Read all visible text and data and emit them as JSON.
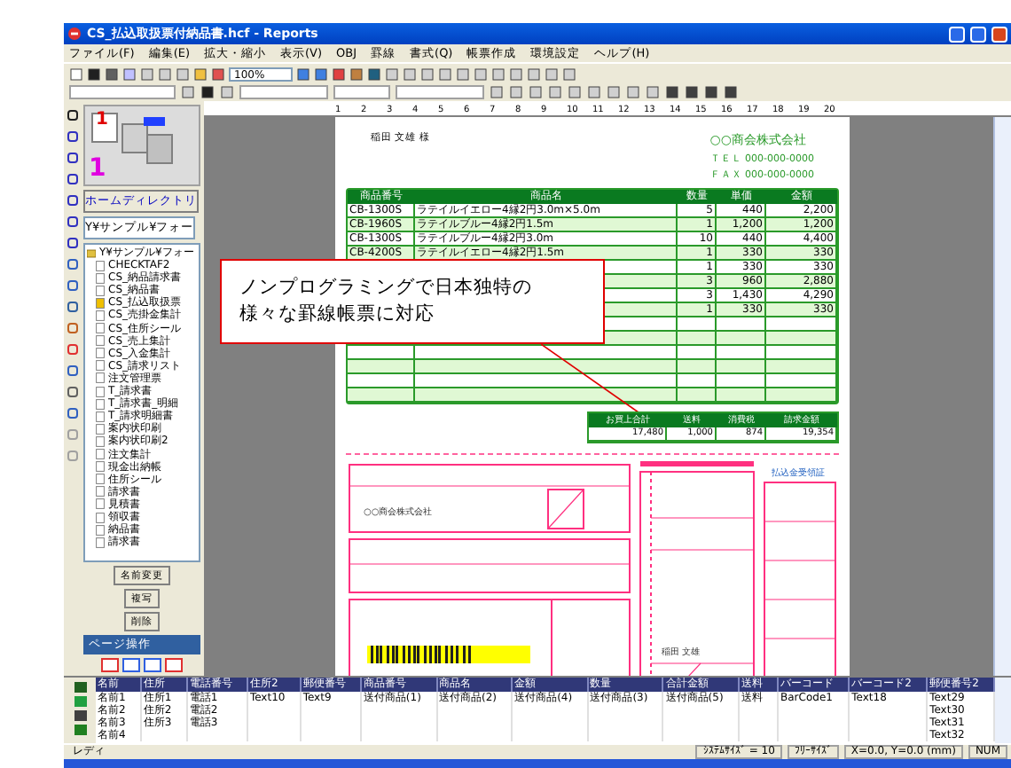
{
  "window": {
    "title": "CS_払込取扱票付納品書.hcf - Reports"
  },
  "menu": [
    "ファイル(F)",
    "編集(E)",
    "拡大・縮小",
    "表示(V)",
    "OBJ",
    "罫線",
    "書式(Q)",
    "帳票作成",
    "環境設定",
    "ヘルプ(H)"
  ],
  "toolbar": {
    "zoom": "100%"
  },
  "ruler": [
    "1",
    "2",
    "3",
    "4",
    "5",
    "6",
    "7",
    "8",
    "9",
    "10",
    "11",
    "12",
    "13",
    "14",
    "15",
    "16",
    "17",
    "18",
    "19",
    "20"
  ],
  "page_panel": {
    "page_number": "1",
    "count": "1"
  },
  "home_button": "ホームディレクトリ",
  "path_field": "Y¥サンプル¥フォー",
  "tree": {
    "label": "Y¥サンプル¥フォー",
    "children": [
      {
        "label": "CHECKTAF2",
        "open": false
      },
      {
        "label": "CS_納品請求書",
        "open": false
      },
      {
        "label": "CS_納品書",
        "open": false
      },
      {
        "label": "CS_払込取扱票",
        "open": true
      },
      {
        "label": "CS_売掛金集計",
        "open": false
      },
      {
        "label": "CS_住所シール",
        "open": false
      },
      {
        "label": "CS_売上集計",
        "open": false
      },
      {
        "label": "CS_入金集計",
        "open": false
      },
      {
        "label": "CS_請求リスト",
        "open": false
      },
      {
        "label": "注文管理票",
        "open": false
      },
      {
        "label": "T_請求書",
        "open": false
      },
      {
        "label": "T_請求書_明細",
        "open": false
      },
      {
        "label": "T_請求明細書",
        "open": false
      },
      {
        "label": "案内状印刷",
        "open": false
      },
      {
        "label": "案内状印刷2",
        "open": false
      },
      {
        "label": "注文集計",
        "open": false
      },
      {
        "label": "現金出納帳",
        "open": false
      },
      {
        "label": "住所シール",
        "open": false
      },
      {
        "label": "請求書",
        "open": false
      },
      {
        "label": "見積書",
        "open": false
      },
      {
        "label": "領収書",
        "open": false
      },
      {
        "label": "納品書",
        "open": false
      },
      {
        "label": "請求書",
        "open": false
      }
    ]
  },
  "panel_buttons": [
    "名前変更",
    "複写",
    "削除"
  ],
  "page_toolbar": {
    "label": "ページ操作"
  },
  "document": {
    "customer": "稲田 文雄 様",
    "company": "○○商会株式会社",
    "tel": "ＴＥＬ 000-000-0000",
    "fax": "ＦＡＸ 000-000-0000",
    "columns": [
      "商品番号",
      "商品名",
      "数量",
      "単価",
      "金額"
    ],
    "rows": [
      [
        "CB-1300S",
        "ラテイルイエロー4縁2円3.0m×5.0m",
        "5",
        "440",
        "2,200"
      ],
      [
        "CB-1960S",
        "ラテイルブルー4縁2円1.5m",
        "1",
        "1,200",
        "1,200"
      ],
      [
        "CB-1300S",
        "ラテイルブルー4縁2円3.0m",
        "10",
        "440",
        "4,400"
      ],
      [
        "CB-4200S",
        "ラテイルイエロー4縁2円1.5m",
        "1",
        "330",
        "330"
      ],
      [
        "",
        "",
        "1",
        "330",
        "330"
      ],
      [
        "",
        "",
        "3",
        "960",
        "2,880"
      ],
      [
        "",
        "",
        "3",
        "1,430",
        "4,290"
      ],
      [
        "",
        "",
        "1",
        "330",
        "330"
      ]
    ],
    "total_columns": [
      "お買上合計",
      "送料",
      "消費税",
      "請求金額"
    ],
    "totals": [
      "17,480",
      "1,000",
      "874",
      "19,354"
    ],
    "form_texts": [
      "○○商会株式会社",
      "払込金受領証",
      "稲田 文雄"
    ]
  },
  "callout": [
    "ノンプログラミングで日本独特の",
    "様々な罫線帳票に対応"
  ],
  "grid": {
    "columns": [
      "名前",
      "住所",
      "電話番号",
      "住所2",
      "郵便番号",
      "商品番号",
      "商品名",
      "金額",
      "数量",
      "合計金額",
      "送料",
      "バーコード",
      "バーコード2",
      "郵便番号2"
    ],
    "rows": [
      [
        "名前1",
        "住所1",
        "電話1",
        "Text10",
        "Text9",
        "送付商品(1)",
        "送付商品(2)",
        "送付商品(4)",
        "送付商品(3)",
        "送付商品(5)",
        "送料",
        "BarCode1",
        "Text18",
        "Text29"
      ],
      [
        "名前2",
        "住所2",
        "電話2",
        "",
        "",
        "",
        "",
        "",
        "",
        "",
        "",
        "",
        "",
        "Text30"
      ],
      [
        "名前3",
        "住所3",
        "電話3",
        "",
        "",
        "",
        "",
        "",
        "",
        "",
        "",
        "",
        "",
        "Text31"
      ],
      [
        "名前4",
        "",
        "",
        "",
        "",
        "",
        "",
        "",
        "",
        "",
        "",
        "",
        "",
        "Text32"
      ]
    ]
  },
  "status_bar": [
    "レディ",
    "ｼｽﾃﾑｻｲｽﾞ = 10",
    "ﾌﾘｰｻｲｽﾞ",
    "X=0.0, Y=0.0 (mm)",
    "NUM"
  ]
}
